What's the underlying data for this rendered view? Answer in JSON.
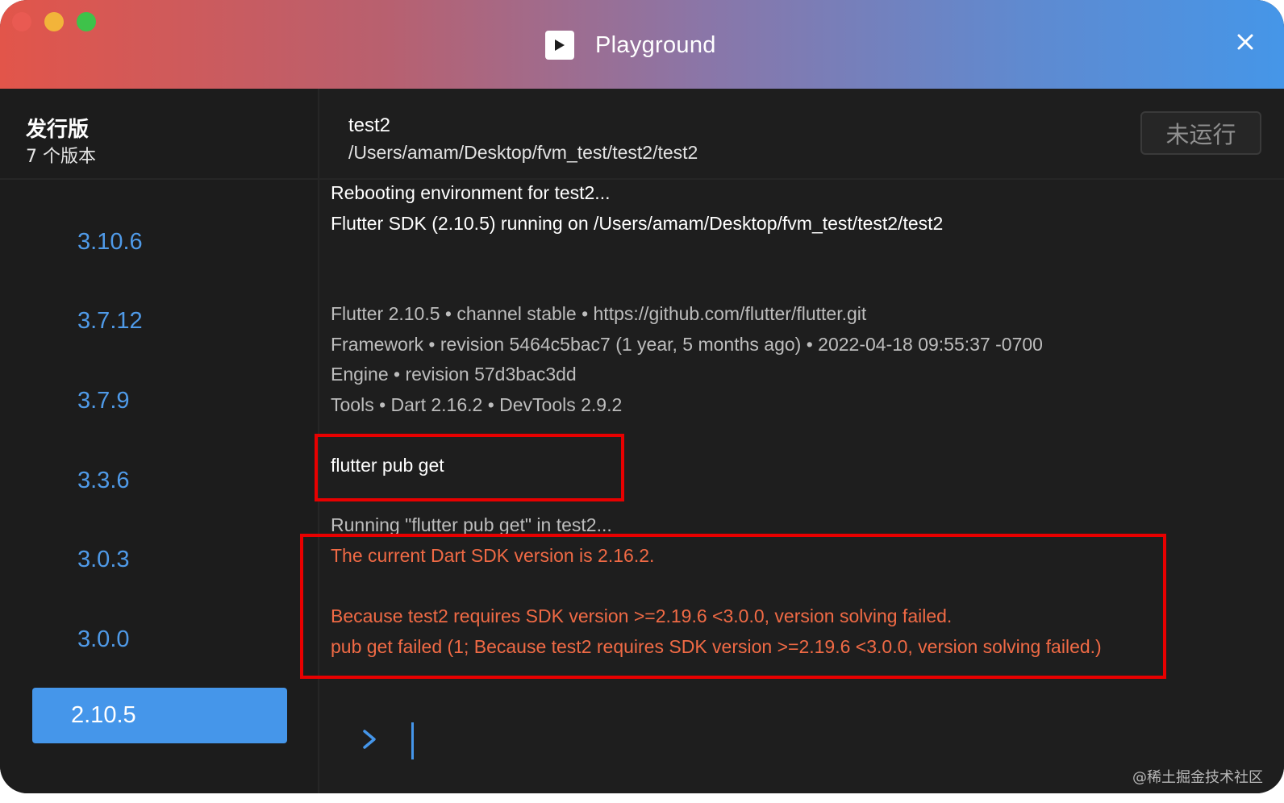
{
  "window": {
    "title": "Playground",
    "colors": {
      "traffic_red": "#e95a52",
      "traffic_yellow": "#f2b43a",
      "traffic_green": "#3ec24a",
      "accent": "#4596ea",
      "error_text": "#f06a45",
      "highlight_box": "#e80000"
    },
    "icons": {
      "title_icon": "play-icon",
      "close": "close-icon"
    }
  },
  "sidebar": {
    "title": "发行版",
    "subtitle": "7 个版本",
    "versions": [
      "3.10.6",
      "3.7.12",
      "3.7.9",
      "3.3.6",
      "3.0.3",
      "3.0.0",
      "2.10.5"
    ],
    "selected": "2.10.5"
  },
  "project": {
    "name": "test2",
    "path": "/Users/amam/Desktop/fvm_test/test2/test2",
    "run_button_label": "未运行"
  },
  "console": {
    "lines": [
      "Rebooting environment for test2...",
      "Flutter SDK (2.10.5) running on /Users/amam/Desktop/fvm_test/test2/test2",
      "Flutter 2.10.5 • channel stable • https://github.com/flutter/flutter.git",
      "Framework • revision 5464c5bac7 (1 year, 5 months ago) • 2022-04-18 09:55:37 -0700",
      "Engine • revision 57d3bac3dd",
      "Tools • Dart 2.16.2 • DevTools 2.9.2",
      "flutter pub get",
      "Running \"flutter pub get\" in test2...",
      "The current Dart SDK version is 2.16.2.",
      "Because test2 requires SDK version >=2.19.6 <3.0.0, version solving failed.",
      "pub get failed (1; Because test2 requires SDK version >=2.19.6 <3.0.0, version solving failed.)"
    ],
    "prompt_icon": "chevron-right-icon"
  },
  "watermark": "@稀土掘金技术社区"
}
